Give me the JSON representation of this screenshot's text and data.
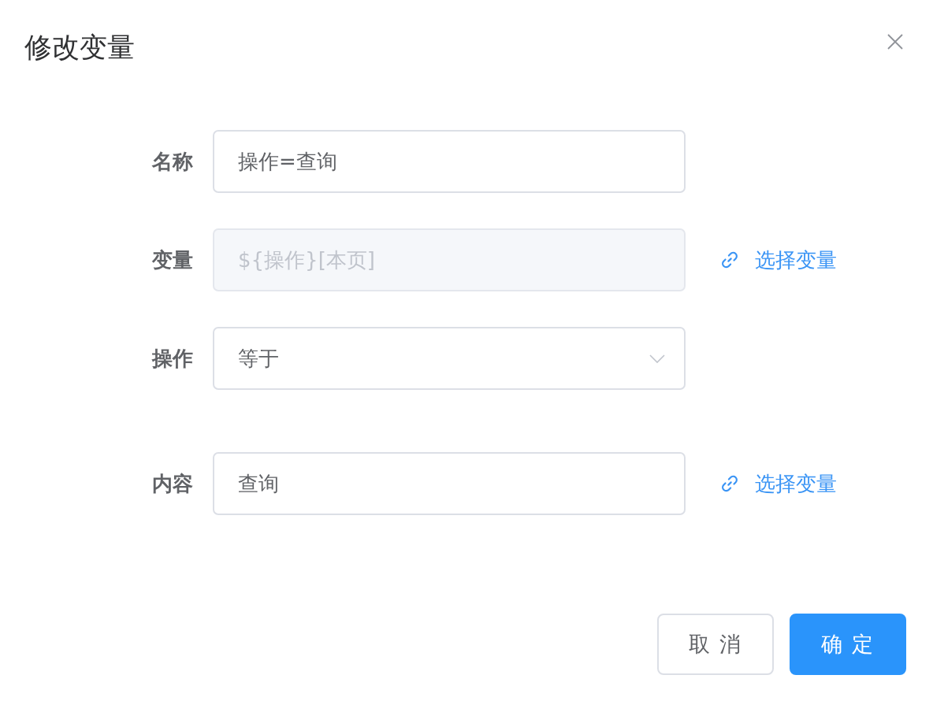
{
  "dialog": {
    "title": "修改变量"
  },
  "fields": [
    {
      "kind": "input",
      "label": "名称",
      "value": "操作=查询",
      "disabled": false
    },
    {
      "kind": "input",
      "label": "变量",
      "value": "${操作}[本页]",
      "disabled": true,
      "link": "选择变量"
    },
    {
      "kind": "select",
      "label": "操作",
      "value": "等于",
      "disabled": false
    },
    {
      "kind": "input",
      "label": "内容",
      "value": "查询",
      "disabled": false,
      "link": "选择变量"
    }
  ],
  "buttons": [
    {
      "label": "取 消",
      "kind": "default"
    },
    {
      "label": "确 定",
      "kind": "primary"
    }
  ]
}
